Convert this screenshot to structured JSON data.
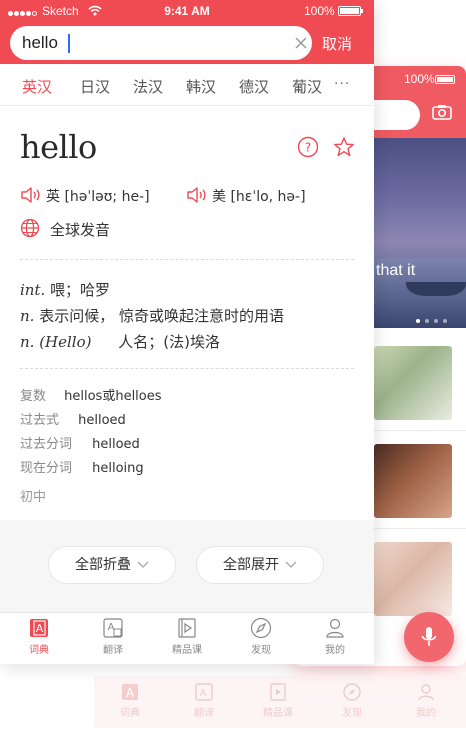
{
  "status": {
    "carrier": "Sketch",
    "time": "9:41 AM",
    "battery": "100%"
  },
  "background_app": {
    "battery": "100%",
    "hero_text": "that it",
    "tabs": [
      "词典",
      "翻译",
      "精品课",
      "发现",
      "我的"
    ]
  },
  "search": {
    "query": "hello",
    "cancel_label": "取消"
  },
  "lang_tabs": {
    "items": [
      "英汉",
      "日汉",
      "法汉",
      "韩汉",
      "德汉",
      "葡汉"
    ],
    "active_index": 0,
    "more": "···"
  },
  "entry": {
    "word": "hello",
    "pron_uk_label": "英",
    "pron_uk": "[həˈləʊ; he-]",
    "pron_us_label": "美",
    "pron_us": "[hɛˈlo, hə-]",
    "global_pron": "全球发音",
    "definitions": [
      {
        "pos": "int.",
        "text": "喂；哈罗"
      },
      {
        "pos": "n.",
        "text": "表示问候，  惊奇或唤起注意时的用语"
      },
      {
        "pos": "n. (Hello)",
        "text": "人名；(法)埃洛"
      }
    ],
    "forms": [
      {
        "label": "复数",
        "value": "hellos或helloes"
      },
      {
        "label": "过去式",
        "value": "helloed"
      },
      {
        "label": "过去分词",
        "value": "helloed"
      },
      {
        "label": "现在分词",
        "value": "helloing"
      }
    ],
    "level": "初中"
  },
  "actions": {
    "collapse_all": "全部折叠",
    "expand_all": "全部展开"
  },
  "tabbar": {
    "items": [
      "词典",
      "翻译",
      "精品课",
      "发现",
      "我的"
    ],
    "active_index": 0
  },
  "colors": {
    "accent": "#f04a52",
    "accent_light": "#f2666d"
  }
}
